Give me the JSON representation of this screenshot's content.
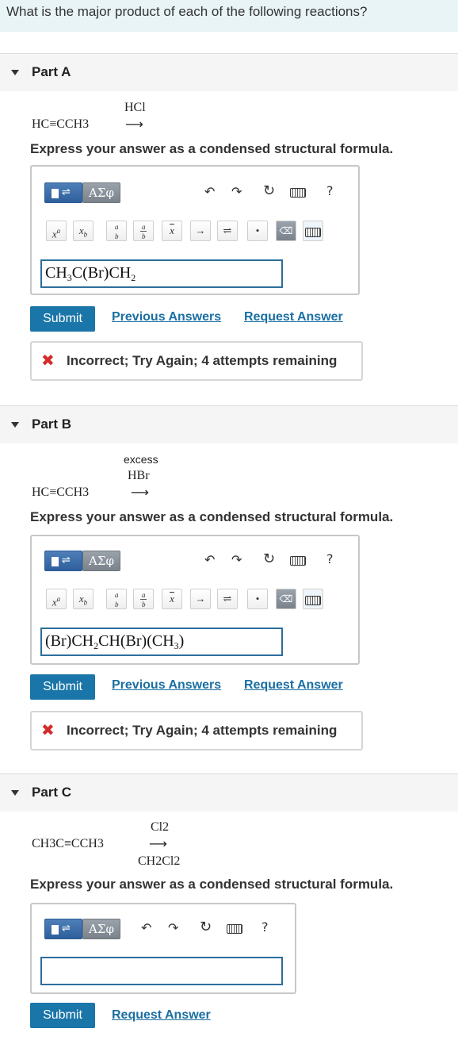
{
  "question": "What is the major product of each of the following reactions?",
  "instruction": "Express your answer as a condensed structural formula.",
  "toolbar": {
    "greek_label": "ΑΣφ",
    "help_label": "?",
    "symbols": [
      "x^a",
      "x_b",
      "a/b",
      "a/b",
      "x̄",
      "→",
      "⇌",
      "•"
    ]
  },
  "buttons": {
    "submit": "Submit",
    "previous_answers": "Previous Answers",
    "request_answer": "Request Answer"
  },
  "parts": [
    {
      "label": "Part A",
      "reactant": "HC≡CCH3",
      "reagent_above": "HCl",
      "reagent_extra": "",
      "reagent_below": "",
      "answer": "CH3C(Br)CH2",
      "feedback": "Incorrect; Try Again; 4 attempts remaining"
    },
    {
      "label": "Part B",
      "reactant": "HC≡CCH3",
      "reagent_extra": "excess",
      "reagent_above": "HBr",
      "reagent_below": "",
      "answer": "(Br)CH2CH(Br)(CH3)",
      "feedback": "Incorrect; Try Again; 4 attempts remaining"
    },
    {
      "label": "Part C",
      "reactant": "CH3C≡CCH3",
      "reagent_above": "Cl2",
      "reagent_extra": "",
      "reagent_below": "CH2Cl2",
      "answer": "",
      "feedback": ""
    }
  ],
  "colors": {
    "submit_bg": "#1a75a8",
    "link": "#1a6fa3",
    "error_x": "#d32b2b",
    "question_bar": "#e9f4f7",
    "answer_border": "#2c6f9b"
  }
}
